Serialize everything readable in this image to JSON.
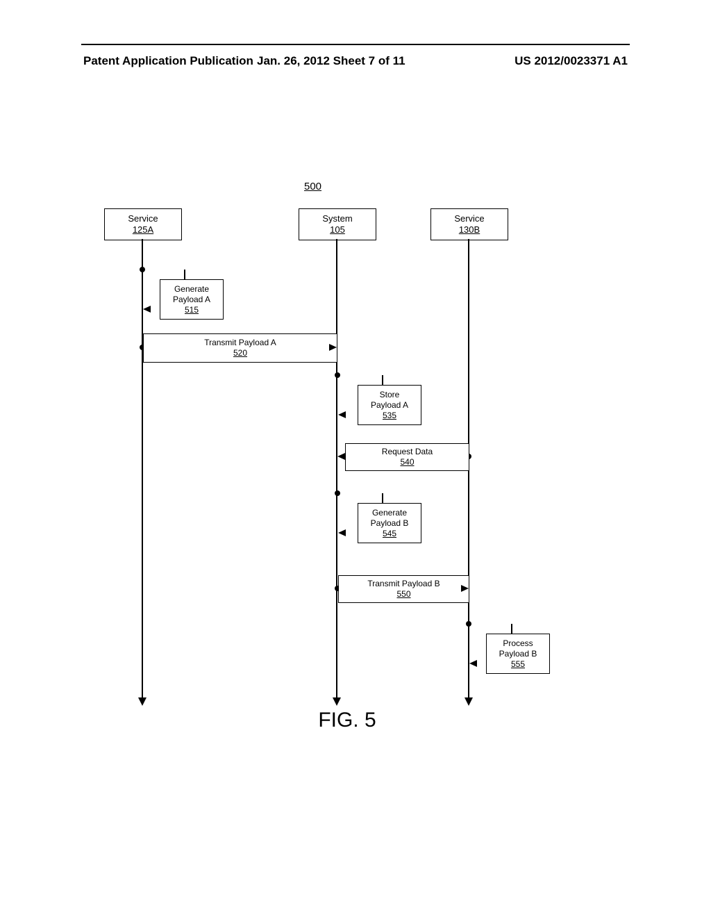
{
  "header": {
    "left": "Patent Application Publication",
    "mid": "Jan. 26, 2012  Sheet 7 of 11",
    "right": "US 2012/0023371 A1"
  },
  "diagram_ref": "500",
  "lifelines": {
    "a": {
      "title": "Service",
      "ref": "125A"
    },
    "b": {
      "title": "System",
      "ref": "105"
    },
    "c": {
      "title": "Service",
      "ref": "130B"
    }
  },
  "steps": {
    "s515": {
      "l1": "Generate",
      "l2": "Payload A",
      "ref": "515"
    },
    "s520": {
      "l1": "Transmit Payload A",
      "ref": "520"
    },
    "s535": {
      "l1": "Store",
      "l2": "Payload A",
      "ref": "535"
    },
    "s540": {
      "l1": "Request Data",
      "ref": "540"
    },
    "s545": {
      "l1": "Generate",
      "l2": "Payload B",
      "ref": "545"
    },
    "s550": {
      "l1": "Transmit Payload B",
      "ref": "550"
    },
    "s555": {
      "l1": "Process",
      "l2": "Payload B",
      "ref": "555"
    }
  },
  "figure_label": "FIG. 5",
  "chart_data": {
    "type": "table",
    "figure": "FIG. 5",
    "reference": "500",
    "participants": [
      {
        "name": "Service",
        "ref": "125A"
      },
      {
        "name": "System",
        "ref": "105"
      },
      {
        "name": "Service",
        "ref": "130B"
      }
    ],
    "messages": [
      {
        "ref": "515",
        "from": "125A",
        "to": "125A",
        "label": "Generate Payload A"
      },
      {
        "ref": "520",
        "from": "125A",
        "to": "105",
        "label": "Transmit Payload A"
      },
      {
        "ref": "535",
        "from": "105",
        "to": "105",
        "label": "Store Payload A"
      },
      {
        "ref": "540",
        "from": "130B",
        "to": "105",
        "label": "Request Data"
      },
      {
        "ref": "545",
        "from": "105",
        "to": "105",
        "label": "Generate Payload B"
      },
      {
        "ref": "550",
        "from": "105",
        "to": "130B",
        "label": "Transmit Payload B"
      },
      {
        "ref": "555",
        "from": "130B",
        "to": "130B",
        "label": "Process Payload B"
      }
    ]
  }
}
